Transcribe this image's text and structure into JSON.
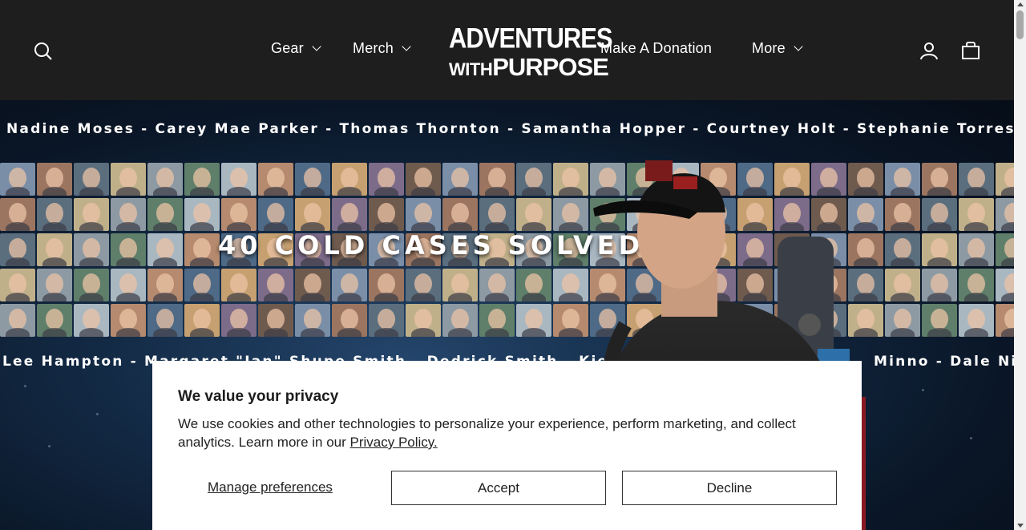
{
  "header": {
    "nav_left": [
      {
        "label": "Gear",
        "has_dropdown": true
      },
      {
        "label": "Merch",
        "has_dropdown": true
      }
    ],
    "logo": {
      "line1": "ADVENTURES",
      "line2_small": "WITH",
      "line2_big": "PURPOSE"
    },
    "nav_right": [
      {
        "label": "Make A Donation",
        "has_dropdown": false
      },
      {
        "label": "More",
        "has_dropdown": true
      }
    ],
    "icons": {
      "search": "search-icon",
      "account": "user-icon",
      "cart": "cart-icon"
    }
  },
  "hero": {
    "names_top": "Nadine Moses - Carey Mae Parker - Thomas Thornton - Samantha Hopper - Courtney Holt - Stephanie Torres - Anni",
    "names_bottom": "Lee Hampton - Margaret \"Jan\" Shupe Smith - Dedrick Smith - Kiely L",
    "names_bottom_right": "Minno - Dale Nic",
    "headline": "40 COLD CASES SOLVED"
  },
  "cookie_banner": {
    "title": "We value your privacy",
    "message": "We use cookies and other technologies to personalize your experience, perform marketing, and collect analytics. Learn more in our ",
    "policy_link": "Privacy Policy.",
    "manage_label": "Manage preferences",
    "accept_label": "Accept",
    "decline_label": "Decline"
  },
  "colors": {
    "header_bg": "#1e1e1e",
    "hero_bg": "#0b1524",
    "banner_bg": "#ffffff"
  }
}
